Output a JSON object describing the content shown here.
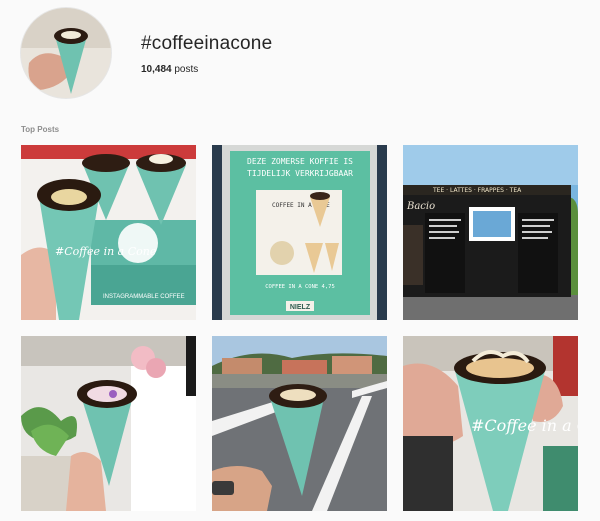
{
  "header": {
    "hashtag": "#coffeeinacone",
    "post_count": "10,484",
    "posts_suffix": " posts"
  },
  "section": {
    "title": "Top Posts"
  },
  "posts": [
    {
      "sign_line1": "",
      "sign_line2": "",
      "box_text": "INSTAGRAMMABLE COFFEE",
      "cone_text": "#Coffee in a Cone"
    },
    {
      "sign_line1": "DEZE ZOMERSE KOFFIE IS",
      "sign_line2": "TIJDELIJK VERKRIJGBAAR",
      "poster_title": "COFFEE IN A CONE",
      "poster_price": "COFFEE IN A CONE  4,75",
      "brand": "NIELZ"
    },
    {
      "truck_text": "TEE · LATTES · FRAPPES · TEA",
      "truck_logo": "Bacio"
    },
    {
      "cone_text": ""
    },
    {
      "cone_text": ""
    },
    {
      "cone_text": "#Coffee in a Cone"
    }
  ],
  "colors": {
    "teal_cup": "#6fc2b0",
    "teal_sign": "#5cbfa2",
    "chocolate": "#3a2418",
    "background": "#fafafa",
    "muted_text": "#8e8e8e"
  }
}
